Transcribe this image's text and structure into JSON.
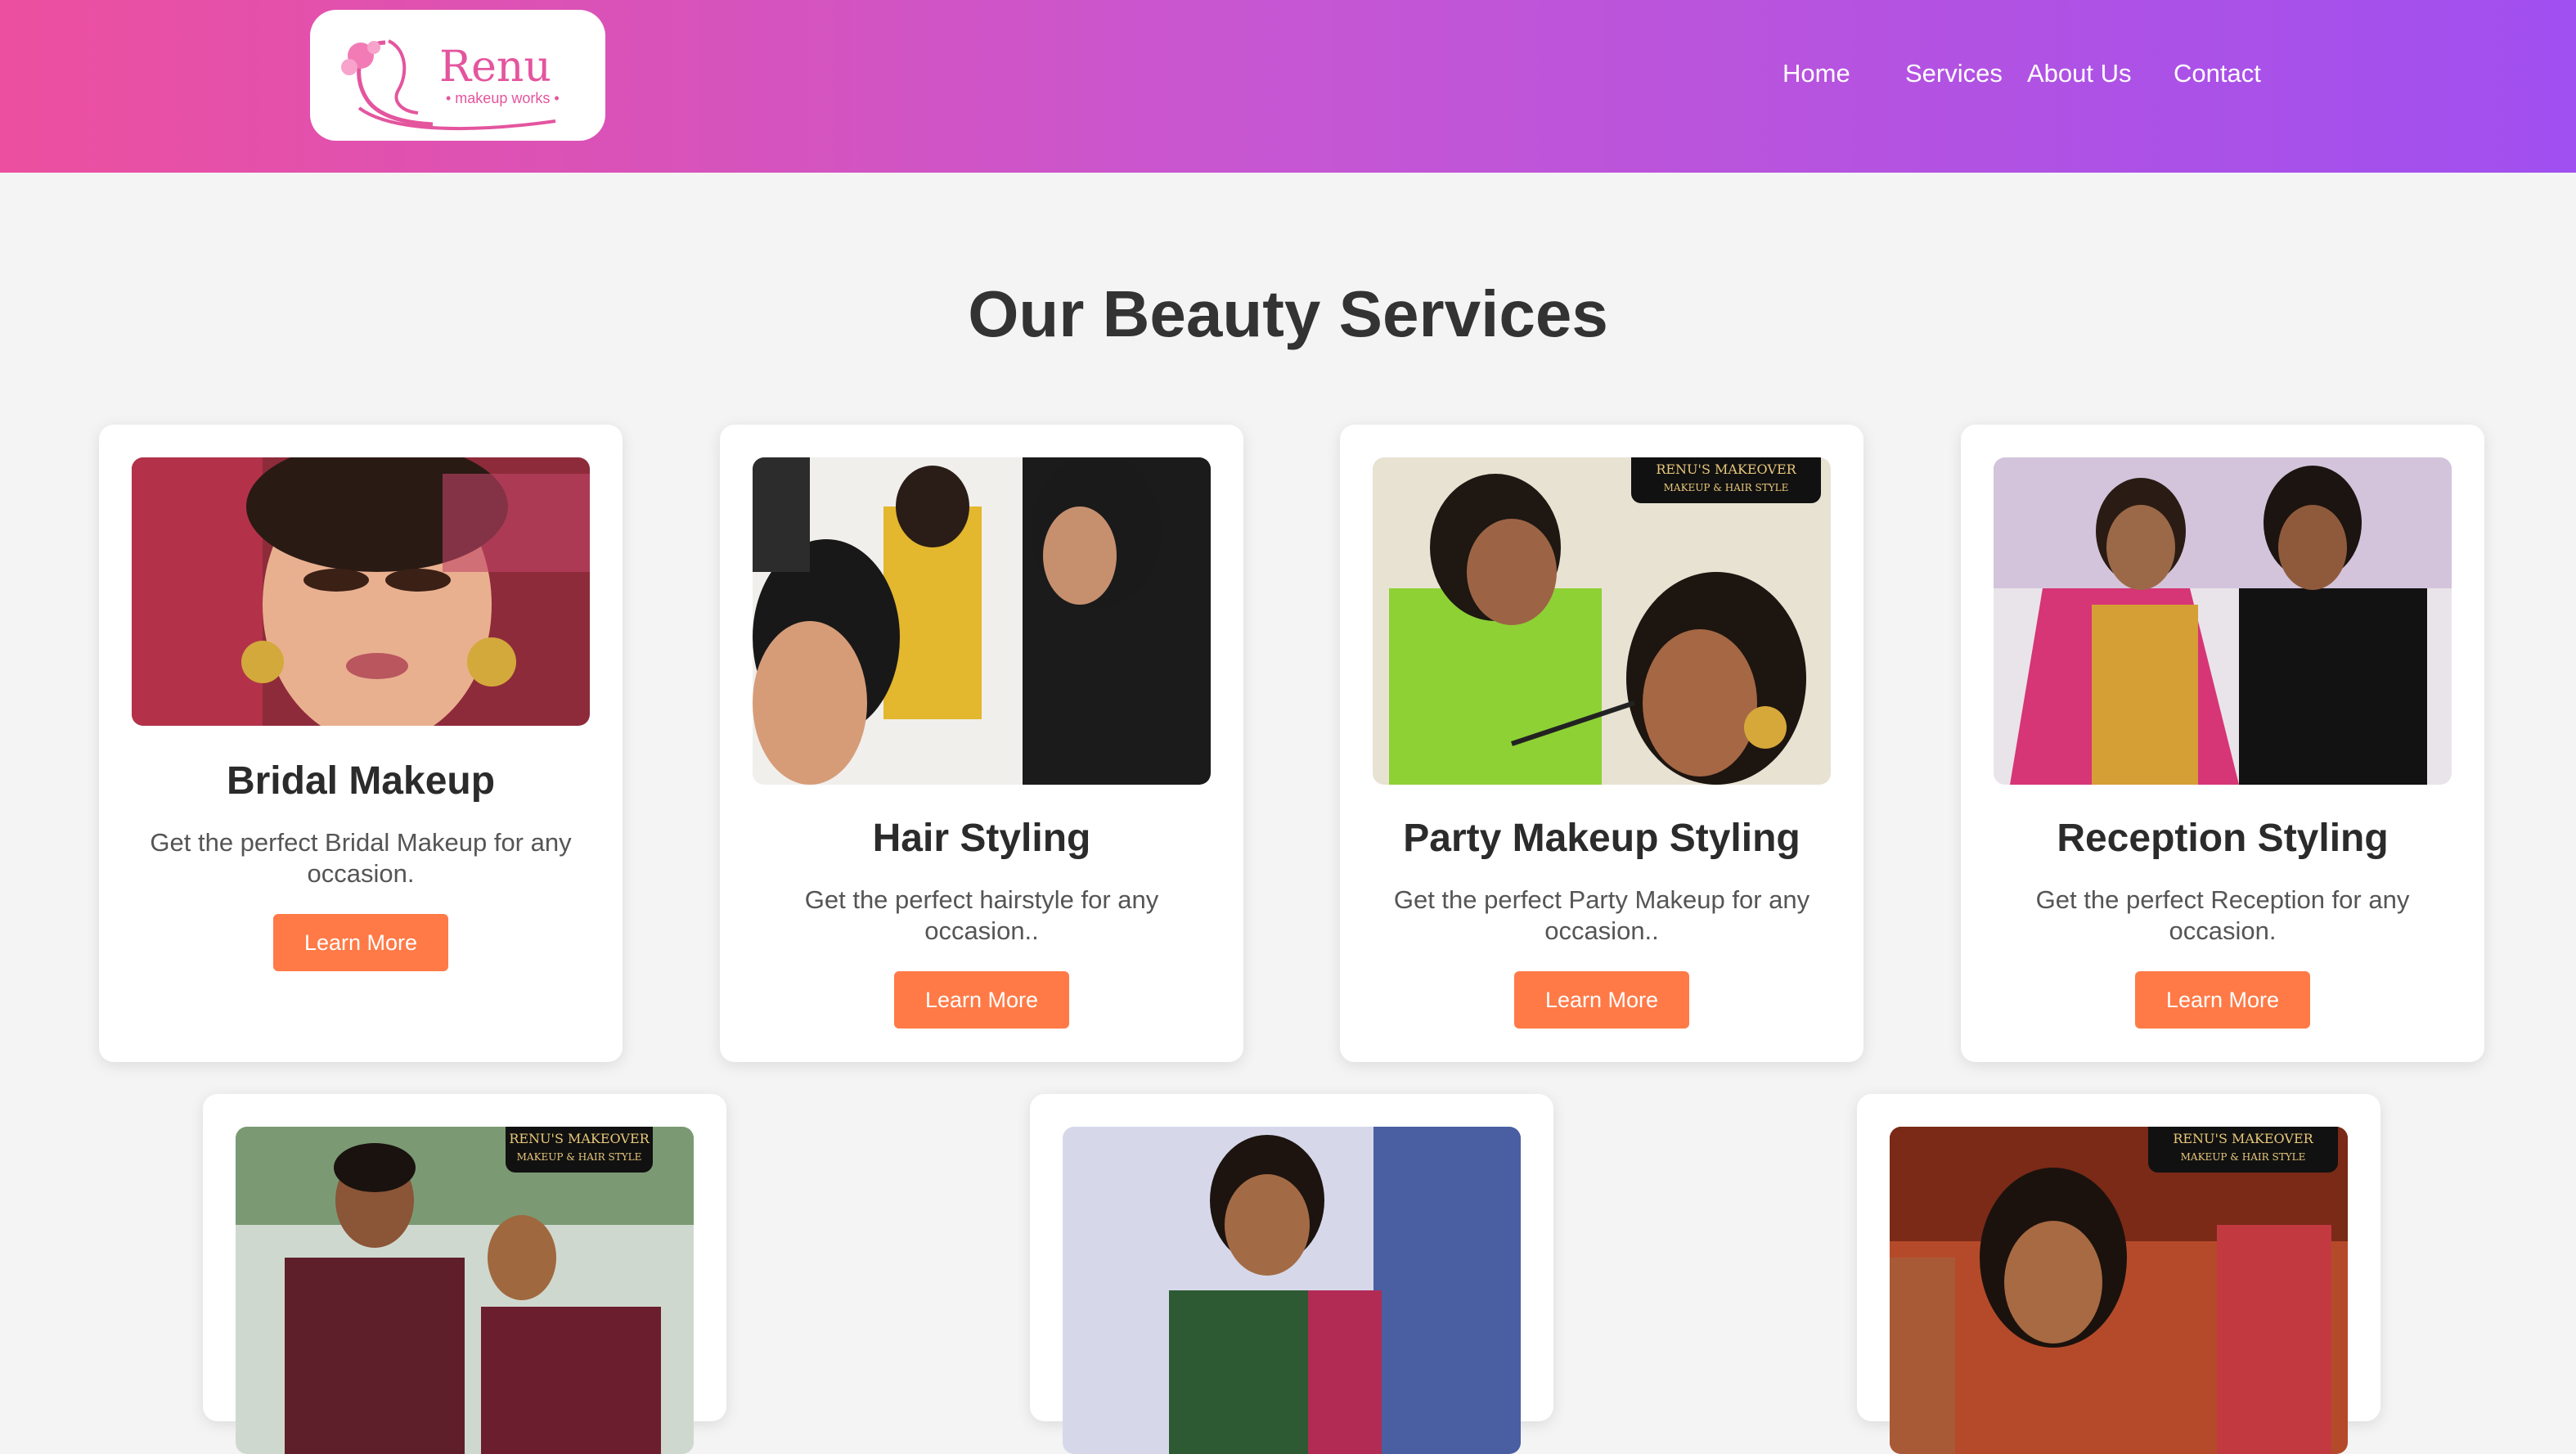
{
  "header": {
    "logo": {
      "name": "Renu",
      "tagline": "• makeup works •"
    },
    "nav": [
      "Home",
      "Services",
      "About Us",
      "Contact"
    ]
  },
  "main": {
    "title": "Our Beauty Services",
    "cards": [
      {
        "title": "Bridal Makeup",
        "description": "Get the perfect Bridal Makeup for any occasion.",
        "button": "Learn More"
      },
      {
        "title": "Hair Styling",
        "description": "Get the perfect hairstyle for any occasion..",
        "button": "Learn More"
      },
      {
        "title": "Party Makeup Styling",
        "description": "Get the perfect Party Makeup for any occasion..",
        "button": "Learn More"
      },
      {
        "title": "Reception Styling",
        "description": "Get the perfect Reception for any occasion.",
        "button": "Learn More"
      }
    ],
    "photo_badge": {
      "line1": "RENU'S MAKEOVER",
      "line2": "MAKEUP & HAIR STYLE"
    }
  },
  "colors": {
    "header_gradient_start": "#ec4f9f",
    "header_gradient_end": "#a04ff0",
    "button": "#ff7a47",
    "background": "#f4f4f4"
  }
}
